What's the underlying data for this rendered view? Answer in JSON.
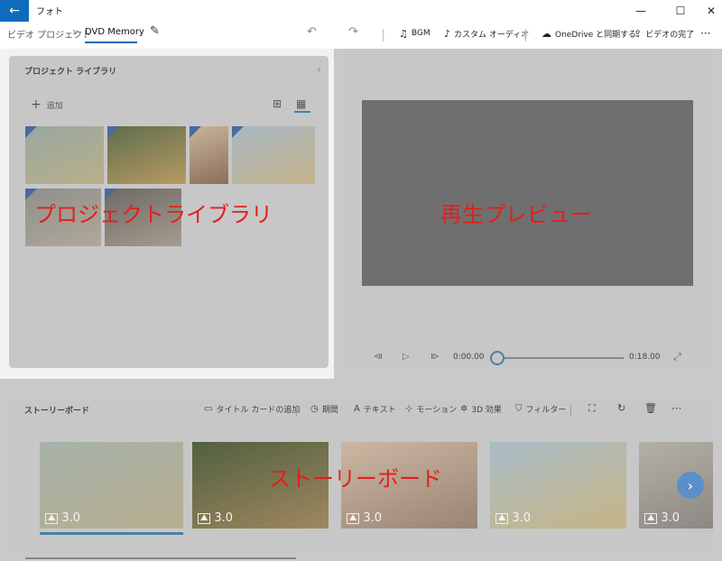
{
  "app": {
    "title": "フォト"
  },
  "window": {
    "minimize": "—",
    "maximize": "☐",
    "close": "✕",
    "back": "←"
  },
  "breadcrumb": {
    "project": "ビデオ プロジェクト",
    "separator": "›",
    "current": "DVD Memory"
  },
  "toolbar": {
    "undo": "↶",
    "redo": "↷",
    "bgm": "BGM",
    "custom_audio": "カスタム オーディオ",
    "onedrive": "OneDrive と同期する",
    "finish_video": "ビデオの完了",
    "more": "···"
  },
  "library": {
    "title": "プロジェクト ライブラリ",
    "add": "追加",
    "overlay": "プロジェクトライブラリ",
    "items": [
      {
        "palette": [
          "#9aa7a0",
          "#b8b08a"
        ]
      },
      {
        "palette": [
          "#5f6e4c",
          "#b89a62"
        ]
      },
      {
        "palette": [
          "#c9b49a",
          "#8a6f5a"
        ]
      },
      {
        "palette": [
          "#a8b8c4",
          "#c6b38a"
        ]
      },
      {
        "palette": [
          "#8f8f8c",
          "#b0a89a"
        ]
      },
      {
        "palette": [
          "#6e6a66",
          "#a79b8e"
        ]
      }
    ]
  },
  "preview": {
    "overlay": "再生プレビュー",
    "current_time": "0:00.00",
    "total_time": "0:18.00",
    "progress": 0
  },
  "storyboard": {
    "title": "ストーリーボード",
    "overlay": "ストーリーボード",
    "tools": {
      "title_card": "タイトル カードの追加",
      "duration": "期間",
      "text": "テキスト",
      "motion": "モーション",
      "effects_3d": "3D 効果",
      "filters": "フィルター"
    },
    "more": "···",
    "cards": [
      {
        "duration": "3.0",
        "palette": [
          "#a6b2aa",
          "#b7ae8f"
        ]
      },
      {
        "duration": "3.0",
        "palette": [
          "#51603f",
          "#a08760"
        ]
      },
      {
        "duration": "3.0",
        "palette": [
          "#cbb8a2",
          "#9a8475"
        ]
      },
      {
        "duration": "3.0",
        "palette": [
          "#a9bcc7",
          "#c7b585"
        ]
      },
      {
        "duration": "3.0",
        "palette": [
          "#b5b0a6",
          "#8c8883"
        ]
      }
    ]
  }
}
